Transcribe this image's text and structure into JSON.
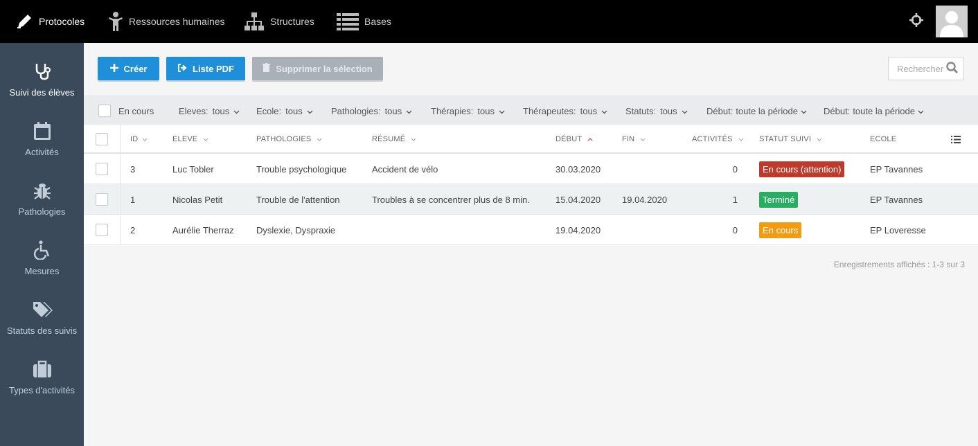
{
  "topnav": {
    "items": [
      {
        "label": "Protocoles",
        "icon": "pencil-icon"
      },
      {
        "label": "Ressources humaines",
        "icon": "person-icon"
      },
      {
        "label": "Structures",
        "icon": "sitemap-icon"
      },
      {
        "label": "Bases",
        "icon": "list-icon"
      }
    ]
  },
  "sidebar": {
    "items": [
      {
        "label": "Suivi des élèves",
        "icon": "stethoscope-icon"
      },
      {
        "label": "Activités",
        "icon": "calendar-icon"
      },
      {
        "label": "Pathologies",
        "icon": "bug-icon"
      },
      {
        "label": "Mesures",
        "icon": "wheelchair-icon"
      },
      {
        "label": "Statuts des suivis",
        "icon": "tags-icon"
      },
      {
        "label": "Types d'activités",
        "icon": "briefcase-icon"
      }
    ]
  },
  "toolbar": {
    "create_label": "Créer",
    "pdf_label": "Liste PDF",
    "delete_label": "Supprimer la sélection"
  },
  "search": {
    "placeholder": "Rechercher"
  },
  "filters": {
    "en_cours": "En cours",
    "items": [
      {
        "label": "Eleves:",
        "value": "tous"
      },
      {
        "label": "Ecole:",
        "value": "tous"
      },
      {
        "label": "Pathologies:",
        "value": "tous"
      },
      {
        "label": "Thérapies:",
        "value": "tous"
      },
      {
        "label": "Thérapeutes:",
        "value": "tous"
      },
      {
        "label": "Statuts:",
        "value": "tous"
      },
      {
        "label": "Début:",
        "value": "toute la période"
      },
      {
        "label": "Début:",
        "value": "toute la période"
      }
    ]
  },
  "table": {
    "columns": [
      "ID",
      "ELEVE",
      "PATHOLOGIES",
      "RÉSUMÉ",
      "DÉBUT",
      "FIN",
      "ACTIVITÉS",
      "STATUT SUIVI",
      "ECOLE"
    ],
    "rows": [
      {
        "id": "3",
        "eleve": "Luc Tobler",
        "pathologies": "Trouble psychologique",
        "resume": "Accident de vélo",
        "debut": "30.03.2020",
        "fin": "",
        "activites": "0",
        "statut": "En cours (attention)",
        "statut_color": "#c0392b",
        "ecole": "EP Tavannes"
      },
      {
        "id": "1",
        "eleve": "Nicolas Petit",
        "pathologies": "Trouble de l'attention",
        "resume": "Troubles à se concentrer plus de 8 min.",
        "debut": "15.04.2020",
        "fin": "19.04.2020",
        "activites": "1",
        "statut": "Terminé",
        "statut_color": "#27ae60",
        "ecole": "EP Tavannes"
      },
      {
        "id": "2",
        "eleve": "Aurélie Therraz",
        "pathologies": "Dyslexie, Dyspraxie",
        "resume": "",
        "debut": "19.04.2020",
        "fin": "",
        "activites": "0",
        "statut": "En cours",
        "statut_color": "#f39c12",
        "ecole": "EP Loveresse"
      }
    ]
  },
  "footer": {
    "records": "Enregistrements affichés : 1-3 sur 3"
  }
}
